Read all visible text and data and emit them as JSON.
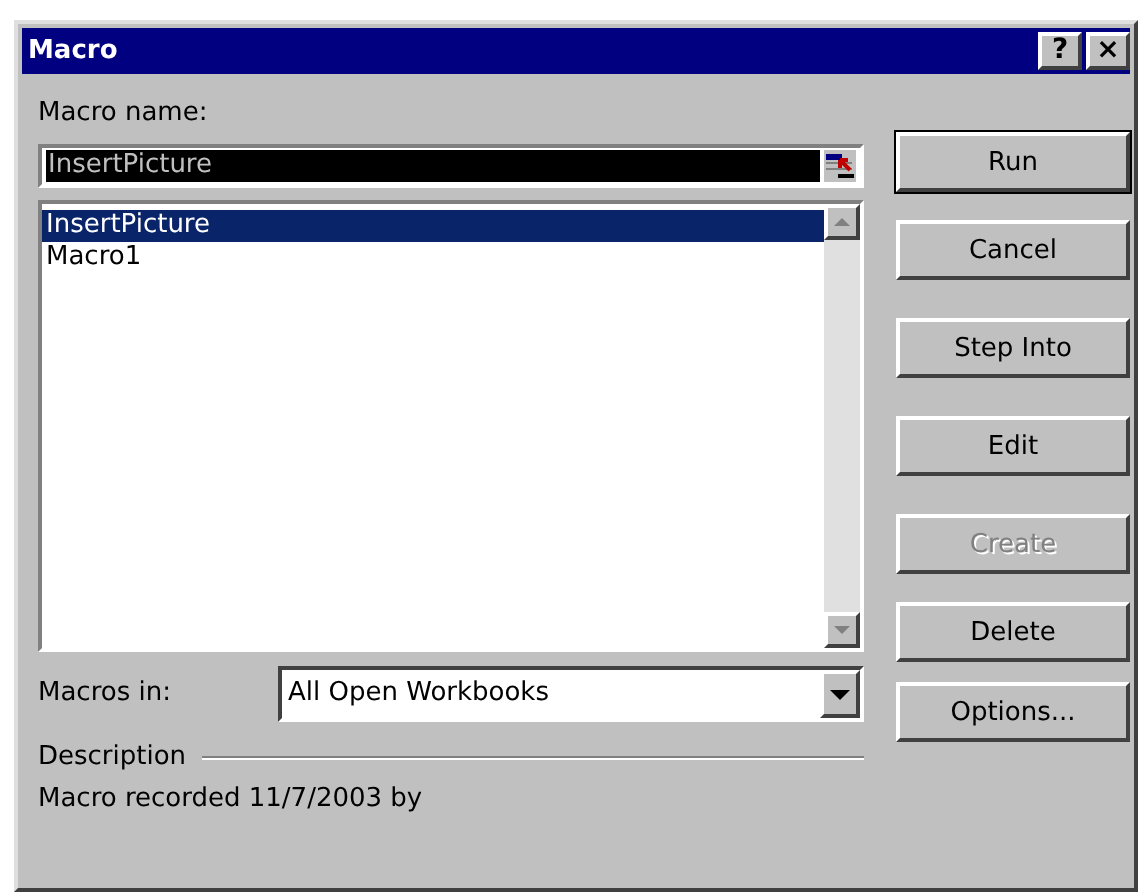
{
  "window": {
    "title": "Macro",
    "title_buttons": [
      "?",
      "×"
    ]
  },
  "macro_name": {
    "label": "Macro name:",
    "value": "InsertPicture",
    "text_selected": true
  },
  "macro_list": {
    "items": [
      {
        "label": "InsertPicture",
        "selected": true
      },
      {
        "label": "Macro1",
        "selected": false
      }
    ]
  },
  "macros_in": {
    "label": "Macros in:",
    "value": "All Open Workbooks"
  },
  "description": {
    "label": "Description",
    "text": "Macro recorded 11/7/2003 by"
  },
  "buttons": [
    {
      "label": "Run",
      "default": true,
      "disabled": false
    },
    {
      "label": "Cancel",
      "default": false,
      "disabled": false
    },
    {
      "label": "Step Into",
      "default": false,
      "disabled": false
    },
    {
      "label": "Edit",
      "default": false,
      "disabled": false
    },
    {
      "label": "Create",
      "default": false,
      "disabled": true
    },
    {
      "label": "Delete",
      "default": false,
      "disabled": false
    },
    {
      "label": "Options...",
      "default": false,
      "disabled": false
    }
  ]
}
